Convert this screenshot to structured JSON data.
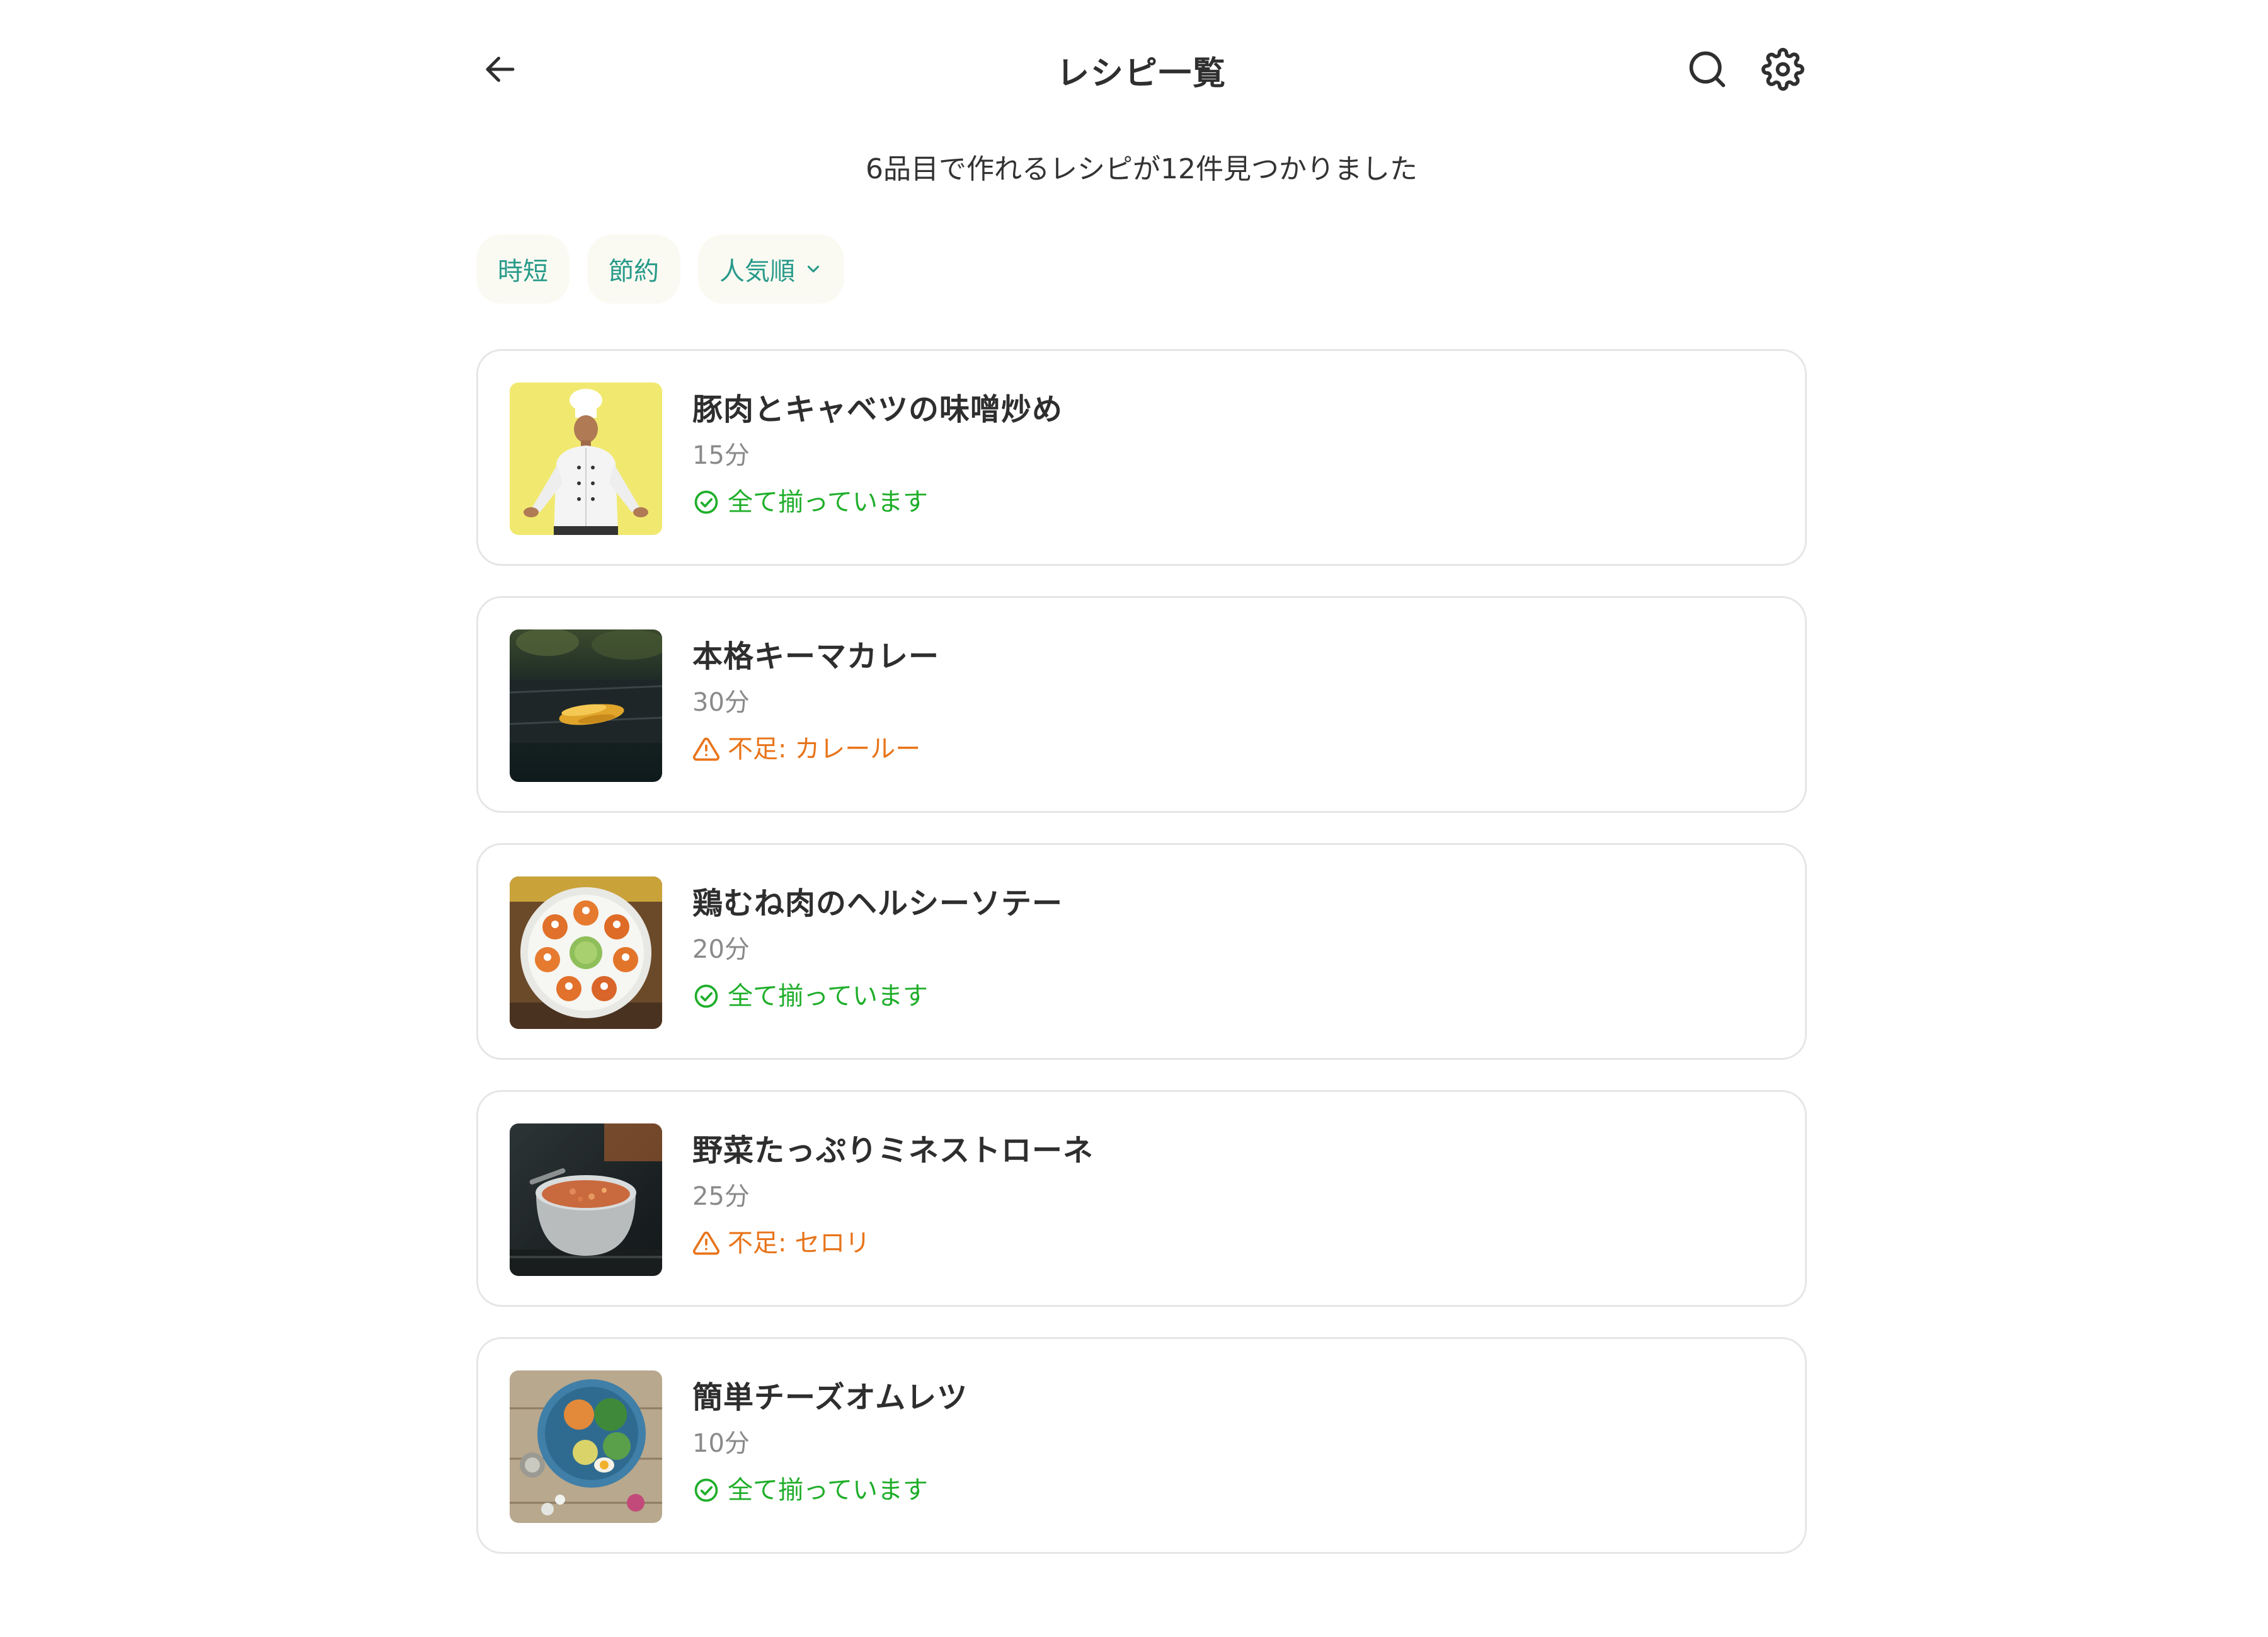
{
  "header": {
    "title": "レシピ一覧",
    "back_icon": "arrow-left-icon",
    "search_icon": "search-icon",
    "settings_icon": "gear-icon"
  },
  "summary": "6品目で作れるレシピが12件見つかりました",
  "filters": [
    {
      "label": "時短"
    },
    {
      "label": "節約"
    },
    {
      "label": "人気順",
      "icon": "chevron-down-icon"
    }
  ],
  "colors": {
    "accent_teal": "#279a8a",
    "ok_green": "#1fae2a",
    "warn_orange": "#e8741a",
    "chip_bg": "#fbfaf2",
    "card_border": "#e6e6e6"
  },
  "recipes": [
    {
      "name": "豚肉とキャベツの味噌炒め",
      "time": "15分",
      "status": "全て揃っています",
      "status_type": "ok",
      "image": "chef-photo"
    },
    {
      "name": "本格キーマカレー",
      "time": "30分",
      "status": "不足: カレールー",
      "status_type": "warn",
      "image": "grilled-corn-photo"
    },
    {
      "name": "鶏むね肉のヘルシーソテー",
      "time": "20分",
      "status": "全て揃っています",
      "status_type": "ok",
      "image": "plated-appetizers-photo"
    },
    {
      "name": "野菜たっぷりミネストローネ",
      "time": "25分",
      "status": "不足: セロリ",
      "status_type": "warn",
      "image": "cooking-pot-photo"
    },
    {
      "name": "簡単チーズオムレツ",
      "time": "10分",
      "status": "全て揃っています",
      "status_type": "ok",
      "image": "salad-bowl-photo"
    }
  ]
}
